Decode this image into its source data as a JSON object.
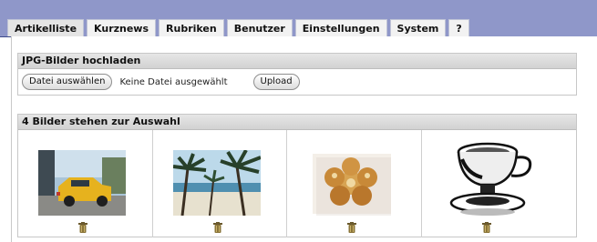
{
  "tabs": [
    {
      "label": "Artikelliste",
      "active": true
    },
    {
      "label": "Kurznews",
      "active": false
    },
    {
      "label": "Rubriken",
      "active": false
    },
    {
      "label": "Benutzer",
      "active": false
    },
    {
      "label": "Einstellungen",
      "active": false
    },
    {
      "label": "System",
      "active": false
    },
    {
      "label": "?",
      "active": false
    }
  ],
  "upload": {
    "heading": "JPG-Bilder hochladen",
    "choose_button": "Datei auswählen",
    "no_file_text": "Keine Datei ausgewählt",
    "upload_button": "Upload"
  },
  "gallery": {
    "heading": "4 Bilder stehen zur Auswahl",
    "images": [
      {
        "subject": "yellow-car-photo",
        "delete_icon": "trash-icon"
      },
      {
        "subject": "palm-beach-photo",
        "delete_icon": "trash-icon"
      },
      {
        "subject": "bread-rolls-photo",
        "delete_icon": "trash-icon"
      },
      {
        "subject": "coffee-cup-drawing",
        "delete_icon": "trash-icon"
      }
    ]
  },
  "colors": {
    "header_band": "#8f97c9",
    "panel_header": "#d9d9d9"
  }
}
